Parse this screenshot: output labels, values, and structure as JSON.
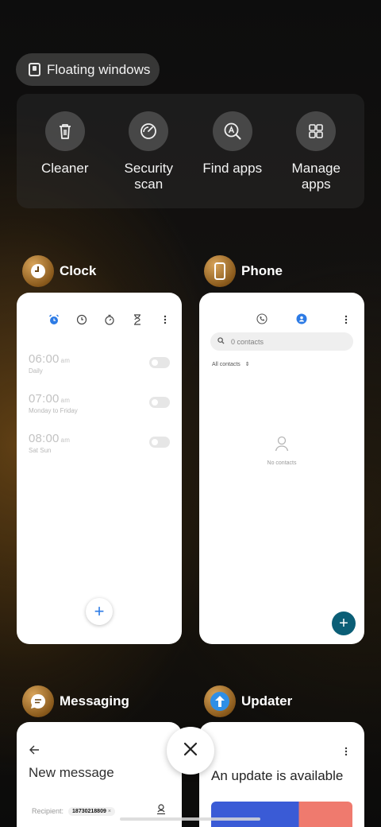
{
  "floating_windows": {
    "label": "Floating windows",
    "icon": "floating-window-icon"
  },
  "tools": [
    {
      "label": "Cleaner",
      "icon": "trash-icon"
    },
    {
      "label": "Security scan",
      "icon": "security-scan-icon"
    },
    {
      "label": "Find apps",
      "icon": "find-apps-icon"
    },
    {
      "label": "Manage apps",
      "icon": "grid-icon"
    }
  ],
  "apps": {
    "clock": {
      "name": "Clock",
      "alarms": [
        {
          "time": "06:00",
          "ampm": "am",
          "repeat": "Daily"
        },
        {
          "time": "07:00",
          "ampm": "am",
          "repeat": "Monday to Friday"
        },
        {
          "time": "08:00",
          "ampm": "am",
          "repeat": "Sat Sun"
        }
      ],
      "fab": "+"
    },
    "phone": {
      "name": "Phone",
      "search_placeholder": "0 contacts",
      "filter": "All contacts",
      "empty_text": "No contacts",
      "fab": "+"
    },
    "messaging": {
      "name": "Messaging",
      "title": "New message",
      "recipient_label": "Recipient:",
      "recipient": "18730218809",
      "chip_remove": "×"
    },
    "updater": {
      "name": "Updater",
      "title": "An update is available"
    }
  },
  "colors": {
    "accent_blue": "#2d7be5",
    "teal_fab": "#0b5e76",
    "updater_blue": "#3a5bd6",
    "updater_coral": "#ef7a6e"
  }
}
